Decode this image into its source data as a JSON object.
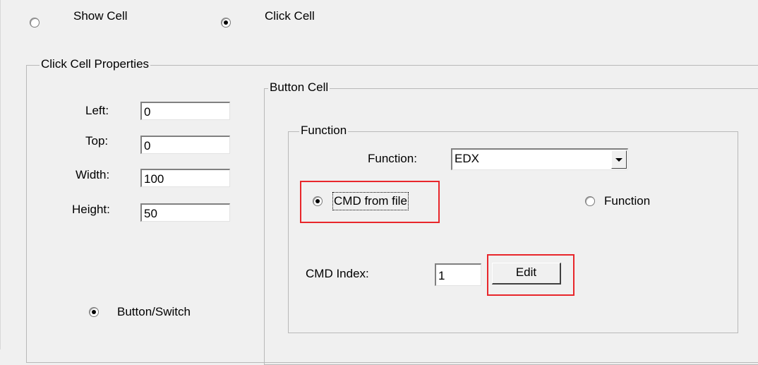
{
  "mode": {
    "show_cell_label": "Show Cell",
    "click_cell_label": "Click Cell",
    "selected": "click_cell"
  },
  "click_cell_properties": {
    "title": "Click Cell Properties",
    "left_label": "Left:",
    "left_value": "0",
    "top_label": "Top:",
    "top_value": "0",
    "width_label": "Width:",
    "width_value": "100",
    "height_label": "Height:",
    "height_value": "50",
    "button_switch_label": "Button/Switch"
  },
  "button_cell": {
    "title": "Button Cell",
    "function_group": {
      "title": "Function",
      "function_label": "Function:",
      "function_value": "EDX",
      "cmd_from_file_label": "CMD from file",
      "function_radio_label": "Function",
      "selected": "cmd_from_file",
      "cmd_index_label": "CMD Index:",
      "cmd_index_value": "1",
      "edit_button_label": "Edit"
    }
  },
  "highlight_color": "#e8262b"
}
